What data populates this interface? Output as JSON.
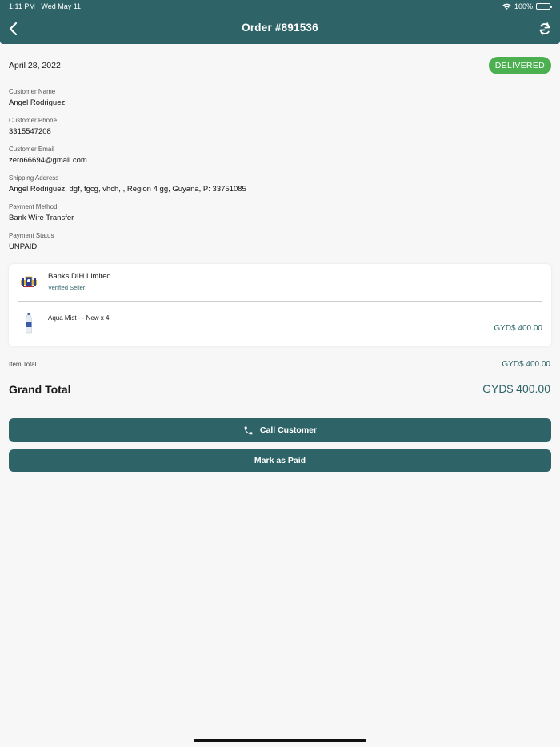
{
  "status_bar": {
    "time": "1:11 PM",
    "date": "Wed May 11",
    "battery": "100%",
    "battery_level": 1.0
  },
  "header": {
    "title": "Order #891536",
    "back_icon": "chevron-left-icon",
    "refresh_icon": "refresh-icon"
  },
  "order": {
    "date": "April 28, 2022",
    "status": "DELIVERED",
    "status_color": "#4caf50"
  },
  "fields": [
    {
      "label": "Customer Name",
      "value": "Angel Rodriguez"
    },
    {
      "label": "Customer Phone",
      "value": "3315547208"
    },
    {
      "label": "Customer Email",
      "value": "zero66694@gmail.com"
    },
    {
      "label": "Shipping Address",
      "value": "Angel Rodriguez, dgf, fgcg, vhch, , Region 4 gg, Guyana, P: 33751085"
    },
    {
      "label": "Payment Method",
      "value": "Bank Wire Transfer"
    },
    {
      "label": "Payment Status",
      "value": "UNPAID"
    }
  ],
  "seller": {
    "name": "Banks DIH Limited",
    "verified": "Verified Seller"
  },
  "items": [
    {
      "name": "Aqua Mist -  - New x 4",
      "price": "GYD$ 400.00"
    }
  ],
  "totals": {
    "item_total_label": "Item Total",
    "item_total_value": "GYD$ 400.00",
    "grand_total_label": "Grand Total",
    "grand_total_value": "GYD$ 400.00"
  },
  "actions": {
    "call_label": "Call Customer",
    "paid_label": "Mark as Paid"
  },
  "colors": {
    "primary": "#2e6468",
    "badge_green": "#4caf50",
    "background": "#f7f7f7"
  }
}
